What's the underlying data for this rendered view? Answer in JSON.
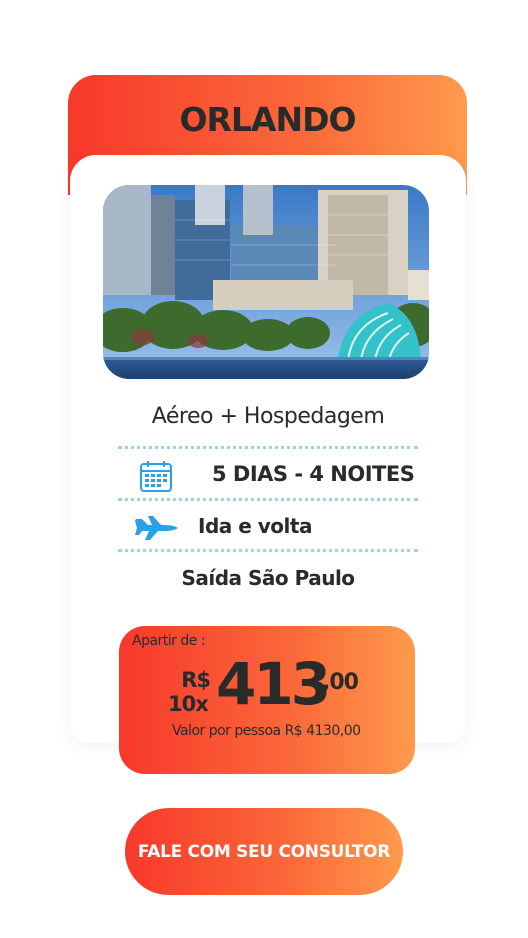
{
  "card": {
    "title": "ORLANDO",
    "image_subject": "Orlando skyline over Lake Eola",
    "package": "Aéreo + Hospedagem",
    "duration": "5 DIAS - 4 NOITES",
    "trip_type": "Ida e volta",
    "departure": "Saída São Paulo",
    "icons": [
      "calendar-icon",
      "airplane-icon"
    ]
  },
  "price": {
    "prefix": "Apartir de :",
    "currency": "R$",
    "installments": "10x",
    "amount": "413",
    "cents": ",00",
    "total_note": "Valor por pessoa R$ 4130,00"
  },
  "cta": {
    "label": "FALE COM SEU CONSULTOR"
  },
  "colors": {
    "gradient_start": "#f8382b",
    "gradient_end": "#ff9a4d",
    "text": "#2a2a2a",
    "divider": "#9fd0ef",
    "icon_blue": "#2aa0e6"
  }
}
